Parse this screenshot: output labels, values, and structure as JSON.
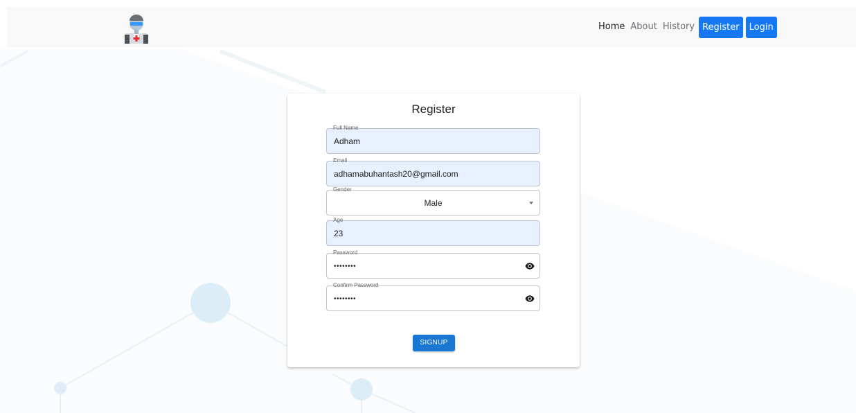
{
  "nav": {
    "home": "Home",
    "about": "About",
    "history": "History",
    "register": "Register",
    "login": "Login"
  },
  "form": {
    "title": "Register",
    "full_name": {
      "label": "Full Name",
      "value": "Adham"
    },
    "email": {
      "label": "Email",
      "value": "adhamabuhantash20@gmail.com"
    },
    "gender": {
      "label": "Gender",
      "value": "Male"
    },
    "age": {
      "label": "Age",
      "value": "23"
    },
    "password": {
      "label": "Password",
      "value": "••••••••"
    },
    "confirm_password": {
      "label": "Confirm Password",
      "value": "••••••••"
    },
    "submit_label": "SIGNUP"
  },
  "colors": {
    "primary": "#1677f3",
    "signup_button": "#1976d2",
    "autofill_bg": "#e8f0fe",
    "navbar_bg": "#f8f8f9"
  },
  "icons": {
    "logo": "doctor-avatar-icon",
    "password_toggle": "eye-icon",
    "select_caret": "caret-down-icon"
  }
}
